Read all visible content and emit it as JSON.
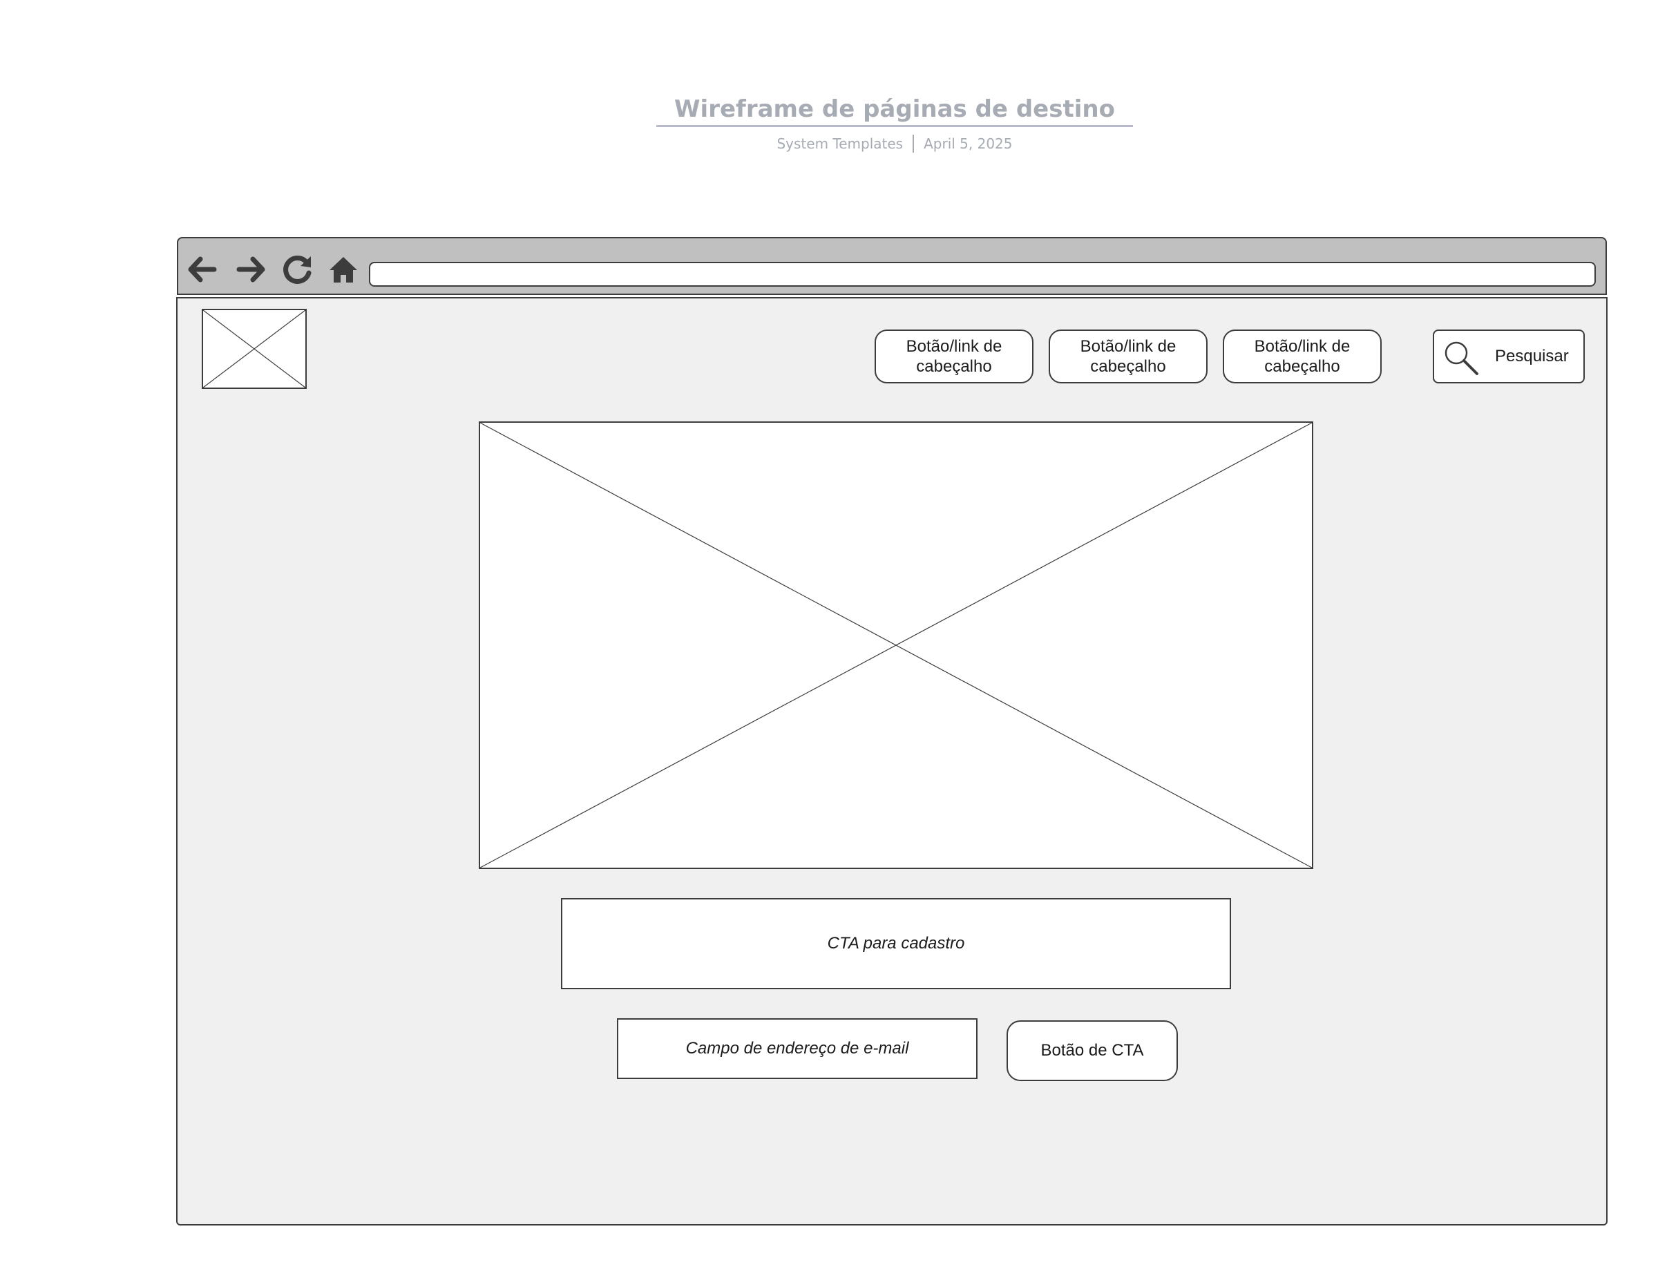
{
  "document": {
    "title": "Wireframe de páginas de destino",
    "author": "System Templates",
    "date": "April 5, 2025"
  },
  "browser": {
    "nav_icons": [
      "back-arrow-icon",
      "forward-arrow-icon",
      "refresh-icon",
      "home-icon"
    ],
    "address_value": ""
  },
  "page": {
    "header_links": [
      {
        "label": "Botão/link de cabeçalho"
      },
      {
        "label": "Botão/link de cabeçalho"
      },
      {
        "label": "Botão/link de cabeçalho"
      }
    ],
    "search": {
      "icon": "magnifier-icon",
      "label": "Pesquisar"
    },
    "cta_signup": "CTA para cadastro",
    "email_placeholder": "Campo de endereço de e-mail",
    "cta_button": "Botão de CTA"
  },
  "colors": {
    "title_text": "#a7abb4",
    "title_underline": "#b9b9cc",
    "toolbar_bg": "#c0c0c0",
    "viewport_bg": "#eff0ef",
    "stroke": "#3c3c3c"
  }
}
